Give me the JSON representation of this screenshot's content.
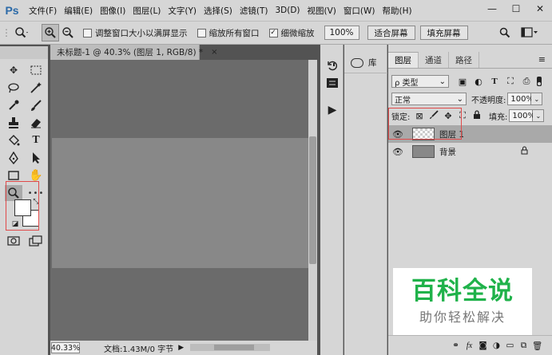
{
  "app": {
    "logo": "Ps",
    "menu": [
      "文件(F)",
      "编辑(E)",
      "图像(I)",
      "图层(L)",
      "文字(Y)",
      "选择(S)",
      "滤镜(T)",
      "3D(D)",
      "视图(V)",
      "窗口(W)",
      "帮助(H)"
    ],
    "window_controls": {
      "minimize": "—",
      "restore": "☐",
      "close": "✕"
    }
  },
  "options_bar": {
    "checkbox_resize": {
      "label": "调整窗口大小以满屏显示",
      "checked": false
    },
    "checkbox_zoom_all": {
      "label": "缩放所有窗口",
      "checked": false
    },
    "checkbox_scrubby": {
      "label": "细微缩放",
      "checked": true
    },
    "zoom_field": "100%",
    "fit_screen": "适合屏幕",
    "fill_screen": "填充屏幕"
  },
  "document": {
    "tab_title": "未标题-1 @ 40.3% (图层 1, RGB/8) *",
    "close_glyph": "×",
    "zoom": "40.33%",
    "info": "文档:1.43M/0 字节"
  },
  "library": {
    "label": "库"
  },
  "layers_panel": {
    "tabs": [
      "图层",
      "通道",
      "路径"
    ],
    "active_tab": "图层",
    "filter_type": "ρ 类型",
    "blend_mode": "正常",
    "opacity_label": "不透明度:",
    "opacity_value": "100%",
    "lock_label": "锁定:",
    "fill_label": "填充:",
    "fill_value": "100%",
    "layers": [
      {
        "name": "图层 1",
        "selected": true,
        "thumb": "transparent"
      },
      {
        "name": "背景",
        "selected": false,
        "thumb": "gray",
        "locked": true
      }
    ],
    "bottom_icons": [
      "link-icon",
      "fx-icon",
      "mask-icon",
      "adjustment-icon",
      "group-icon",
      "new-layer-icon",
      "delete-icon"
    ],
    "fx_label": "fx"
  },
  "watermark": {
    "title": "百科全说",
    "subtitle": "助你轻松解决"
  },
  "colors": {
    "ui_gray": "#d6d6d6",
    "canvas_bg": "#6b6b6b",
    "canvas": "#888888",
    "annotation_red": "#e04a4a",
    "watermark_green": "#1fb24a"
  }
}
